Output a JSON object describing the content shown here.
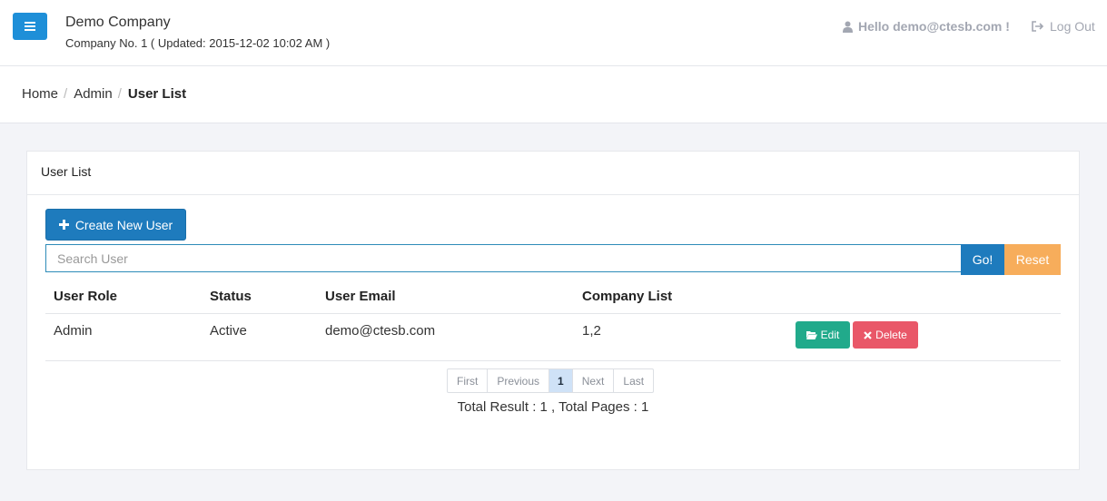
{
  "header": {
    "company_name": "Demo Company",
    "company_sub": "Company No. 1 ( Updated: 2015-12-02 10:02 AM )",
    "hello": "Hello demo@ctesb.com !",
    "logout": "Log Out"
  },
  "breadcrumb": {
    "items": [
      "Home",
      "Admin",
      "User List"
    ]
  },
  "panel": {
    "title": "User List",
    "create_label": "Create New User",
    "search_placeholder": "Search User",
    "go_label": "Go!",
    "reset_label": "Reset"
  },
  "table": {
    "headers": [
      "User Role",
      "Status",
      "User Email",
      "Company List"
    ],
    "rows": [
      {
        "role": "Admin",
        "status": "Active",
        "email": "demo@ctesb.com",
        "companies": "1,2",
        "edit_label": "Edit",
        "delete_label": "Delete"
      }
    ]
  },
  "pagination": {
    "first": "First",
    "previous": "Previous",
    "current": "1",
    "next": "Next",
    "last": "Last",
    "totals": "Total Result : 1 , Total Pages : 1"
  },
  "colors": {
    "primary": "#1e7bbd",
    "menu": "#1e8fd8",
    "reset": "#f7ad5b",
    "edit": "#21aa8b",
    "delete": "#e95768",
    "background": "#f3f4f8"
  },
  "icons": {
    "menu": "hamburger-icon",
    "user": "user-icon",
    "logout": "sign-out-icon",
    "create": "plus-icon",
    "edit": "folder-open-icon",
    "delete": "times-icon"
  }
}
